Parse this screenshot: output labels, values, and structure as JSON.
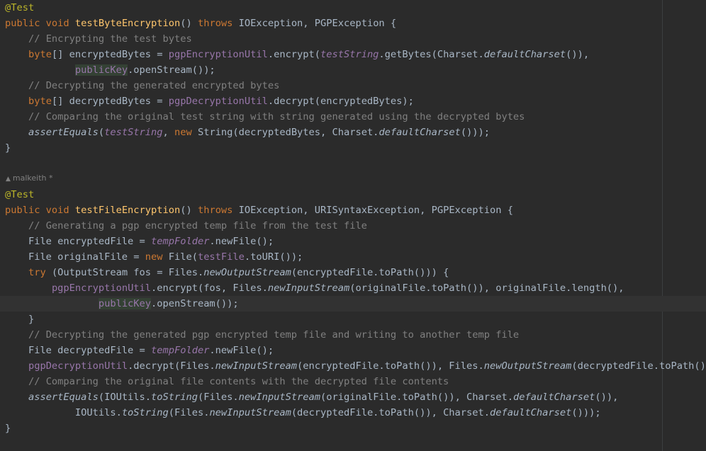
{
  "editor": {
    "author_annotation": {
      "icon": "user-icon",
      "text": "malkeith *"
    },
    "lines": [
      {
        "tokens": [
          [
            "ann",
            "@Test"
          ]
        ]
      },
      {
        "tokens": [
          [
            "kw",
            "public void "
          ],
          [
            "fn",
            "testByteEncryption"
          ],
          [
            "plain",
            "() "
          ],
          [
            "kw",
            "throws "
          ],
          [
            "plain",
            "IOException, PGPException {"
          ]
        ]
      },
      {
        "tokens": [
          [
            "plain",
            "    "
          ],
          [
            "cmt",
            "// Encrypting the test bytes"
          ]
        ]
      },
      {
        "tokens": [
          [
            "plain",
            "    "
          ],
          [
            "kw",
            "byte"
          ],
          [
            "plain",
            "[] encryptedBytes = "
          ],
          [
            "field",
            "pgpEncryptionUtil"
          ],
          [
            "plain",
            ".encrypt("
          ],
          [
            "sfield",
            "testString"
          ],
          [
            "plain",
            ".getBytes(Charset."
          ],
          [
            "smeth",
            "defaultCharset"
          ],
          [
            "plain",
            "()),"
          ]
        ]
      },
      {
        "tokens": [
          [
            "plain",
            "            "
          ],
          [
            "field hl",
            "publicKey"
          ],
          [
            "plain",
            ".openStream());"
          ]
        ]
      },
      {
        "tokens": [
          [
            "plain",
            "    "
          ],
          [
            "cmt",
            "// Decrypting the generated encrypted bytes"
          ]
        ]
      },
      {
        "tokens": [
          [
            "plain",
            "    "
          ],
          [
            "kw",
            "byte"
          ],
          [
            "plain",
            "[] decryptedBytes = "
          ],
          [
            "field",
            "pgpDecryptionUtil"
          ],
          [
            "plain",
            ".decrypt(encryptedBytes);"
          ]
        ]
      },
      {
        "tokens": [
          [
            "plain",
            "    "
          ],
          [
            "cmt",
            "// Comparing the original test string with string generated using the decrypted bytes"
          ]
        ]
      },
      {
        "tokens": [
          [
            "plain",
            "    "
          ],
          [
            "smeth",
            "assertEquals"
          ],
          [
            "plain",
            "("
          ],
          [
            "sfield",
            "testString"
          ],
          [
            "plain",
            ", "
          ],
          [
            "kw",
            "new "
          ],
          [
            "plain",
            "String(decryptedBytes, Charset."
          ],
          [
            "smeth",
            "defaultCharset"
          ],
          [
            "plain",
            "()));"
          ]
        ]
      },
      {
        "tokens": [
          [
            "plain",
            "}"
          ]
        ]
      },
      {
        "tokens": []
      },
      {
        "tokens": []
      },
      {
        "tokens": [
          [
            "ann",
            "@Test"
          ]
        ]
      },
      {
        "tokens": [
          [
            "kw",
            "public void "
          ],
          [
            "fn",
            "testFileEncryption"
          ],
          [
            "plain",
            "() "
          ],
          [
            "kw",
            "throws "
          ],
          [
            "plain",
            "IOException, URISyntaxException, PGPException {"
          ]
        ]
      },
      {
        "tokens": [
          [
            "plain",
            "    "
          ],
          [
            "cmt",
            "// Generating a pgp encrypted temp file from the test file"
          ]
        ]
      },
      {
        "tokens": [
          [
            "plain",
            "    File encryptedFile = "
          ],
          [
            "sfield",
            "tempFolder"
          ],
          [
            "plain",
            ".newFile();"
          ]
        ]
      },
      {
        "tokens": [
          [
            "plain",
            "    File originalFile = "
          ],
          [
            "kw",
            "new "
          ],
          [
            "plain",
            "File("
          ],
          [
            "field",
            "testFile"
          ],
          [
            "plain",
            ".toURI());"
          ]
        ]
      },
      {
        "tokens": [
          [
            "plain",
            "    "
          ],
          [
            "kw",
            "try "
          ],
          [
            "plain",
            "(OutputStream fos = Files."
          ],
          [
            "smeth",
            "newOutputStream"
          ],
          [
            "plain",
            "(encryptedFile.toPath())) {"
          ]
        ]
      },
      {
        "tokens": [
          [
            "plain",
            "        "
          ],
          [
            "field",
            "pgpEncryptionUtil"
          ],
          [
            "plain",
            ".encrypt(fos, Files."
          ],
          [
            "smeth",
            "newInputStream"
          ],
          [
            "plain",
            "(originalFile.toPath()), originalFile.length(),"
          ]
        ]
      },
      {
        "current": true,
        "tokens": [
          [
            "plain",
            "                "
          ],
          [
            "field hl",
            "publicKey"
          ],
          [
            "plain",
            ".openStream());"
          ]
        ]
      },
      {
        "tokens": [
          [
            "plain",
            "    }"
          ]
        ]
      },
      {
        "tokens": [
          [
            "plain",
            "    "
          ],
          [
            "cmt",
            "// Decrypting the generated pgp encrypted temp file and writing to another temp file"
          ]
        ]
      },
      {
        "tokens": [
          [
            "plain",
            "    File decryptedFile = "
          ],
          [
            "sfield",
            "tempFolder"
          ],
          [
            "plain",
            ".newFile();"
          ]
        ]
      },
      {
        "tokens": [
          [
            "plain",
            "    "
          ],
          [
            "field",
            "pgpDecryptionUtil"
          ],
          [
            "plain",
            ".decrypt(Files."
          ],
          [
            "smeth",
            "newInputStream"
          ],
          [
            "plain",
            "(encryptedFile.toPath()), Files."
          ],
          [
            "smeth",
            "newOutputStream"
          ],
          [
            "plain",
            "(decryptedFile.toPath()));"
          ]
        ]
      },
      {
        "tokens": [
          [
            "plain",
            "    "
          ],
          [
            "cmt",
            "// Comparing the original file contents with the decrypted file contents"
          ]
        ]
      },
      {
        "tokens": [
          [
            "plain",
            "    "
          ],
          [
            "smeth",
            "assertEquals"
          ],
          [
            "plain",
            "(IOUtils."
          ],
          [
            "smeth",
            "toString"
          ],
          [
            "plain",
            "(Files."
          ],
          [
            "smeth",
            "newInputStream"
          ],
          [
            "plain",
            "(originalFile.toPath()), Charset."
          ],
          [
            "smeth",
            "defaultCharset"
          ],
          [
            "plain",
            "()),"
          ]
        ]
      },
      {
        "tokens": [
          [
            "plain",
            "            IOUtils."
          ],
          [
            "smeth",
            "toString"
          ],
          [
            "plain",
            "(Files."
          ],
          [
            "smeth",
            "newInputStream"
          ],
          [
            "plain",
            "(decryptedFile.toPath()), Charset."
          ],
          [
            "smeth",
            "defaultCharset"
          ],
          [
            "plain",
            "()));"
          ]
        ]
      },
      {
        "tokens": [
          [
            "plain",
            "}"
          ]
        ]
      }
    ]
  }
}
